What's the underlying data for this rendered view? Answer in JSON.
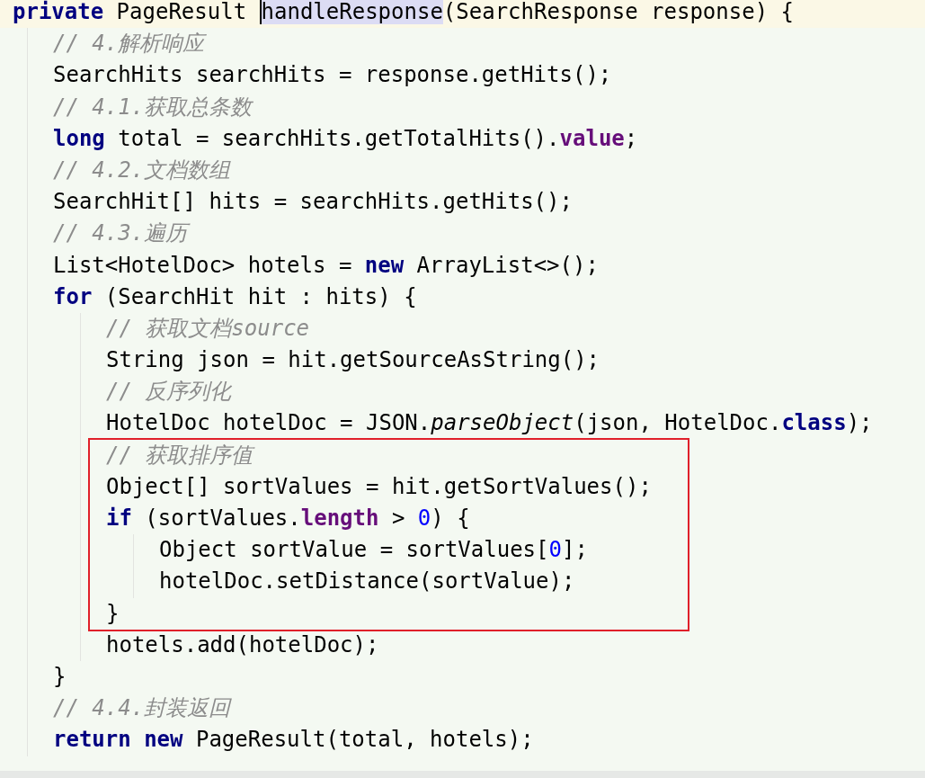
{
  "editor": {
    "lines": [
      {
        "kind": "line",
        "current": true,
        "tokens": [
          {
            "kind": "keyword",
            "text": "private"
          },
          {
            "kind": "text",
            "text": " PageResult "
          },
          {
            "kind": "match",
            "text": "handleResponse"
          },
          {
            "kind": "text",
            "text": "(SearchResponse response) {"
          }
        ],
        "children": [
          {
            "kind": "line",
            "tokens": [
              {
                "kind": "comment",
                "text": "// 4.解析响应"
              }
            ]
          },
          {
            "kind": "line",
            "tokens": [
              {
                "kind": "text",
                "text": "SearchHits searchHits = response.getHits();"
              }
            ]
          },
          {
            "kind": "line",
            "tokens": [
              {
                "kind": "comment",
                "text": "// 4.1.获取总条数"
              }
            ]
          },
          {
            "kind": "line",
            "tokens": [
              {
                "kind": "keyword",
                "text": "long"
              },
              {
                "kind": "text",
                "text": " total = searchHits.getTotalHits()."
              },
              {
                "kind": "field",
                "text": "value"
              },
              {
                "kind": "text",
                "text": ";"
              }
            ]
          },
          {
            "kind": "line",
            "tokens": [
              {
                "kind": "comment",
                "text": "// 4.2.文档数组"
              }
            ]
          },
          {
            "kind": "line",
            "tokens": [
              {
                "kind": "text",
                "text": "SearchHit[] hits = searchHits.getHits();"
              }
            ]
          },
          {
            "kind": "line",
            "tokens": [
              {
                "kind": "comment",
                "text": "// 4.3.遍历"
              }
            ]
          },
          {
            "kind": "line",
            "tokens": [
              {
                "kind": "text",
                "text": "List<HotelDoc> hotels = "
              },
              {
                "kind": "keyword",
                "text": "new"
              },
              {
                "kind": "text",
                "text": " ArrayList<>();"
              }
            ]
          },
          {
            "kind": "line",
            "tokens": [
              {
                "kind": "keyword",
                "text": "for"
              },
              {
                "kind": "text",
                "text": " (SearchHit hit : hits) {"
              }
            ],
            "children": [
              {
                "kind": "line",
                "tokens": [
                  {
                    "kind": "comment",
                    "text": "// 获取文档source"
                  }
                ]
              },
              {
                "kind": "line",
                "tokens": [
                  {
                    "kind": "text",
                    "text": "String json = hit.getSourceAsString();"
                  }
                ]
              },
              {
                "kind": "line",
                "tokens": [
                  {
                    "kind": "comment",
                    "text": "// 反序列化"
                  }
                ]
              },
              {
                "kind": "line",
                "tokens": [
                  {
                    "kind": "text",
                    "text": "HotelDoc hotelDoc = JSON."
                  },
                  {
                    "kind": "italic",
                    "text": "parseObject"
                  },
                  {
                    "kind": "text",
                    "text": "(json, HotelDoc."
                  },
                  {
                    "kind": "keyword",
                    "text": "class"
                  },
                  {
                    "kind": "text",
                    "text": ");"
                  }
                ]
              },
              {
                "kind": "marked_region",
                "children": [
                  {
                    "kind": "line",
                    "tokens": [
                      {
                        "kind": "comment",
                        "text": "// 获取排序值"
                      }
                    ]
                  },
                  {
                    "kind": "line",
                    "tokens": [
                      {
                        "kind": "text",
                        "text": "Object[] sortValues = hit.getSortValues();"
                      }
                    ]
                  },
                  {
                    "kind": "line",
                    "tokens": [
                      {
                        "kind": "keyword",
                        "text": "if"
                      },
                      {
                        "kind": "text",
                        "text": " (sortValues."
                      },
                      {
                        "kind": "field",
                        "text": "length"
                      },
                      {
                        "kind": "text",
                        "text": " > "
                      },
                      {
                        "kind": "number",
                        "text": "0"
                      },
                      {
                        "kind": "text",
                        "text": ") {"
                      }
                    ],
                    "children": [
                      {
                        "kind": "line",
                        "tokens": [
                          {
                            "kind": "text",
                            "text": "Object sortValue = sortValues["
                          },
                          {
                            "kind": "number",
                            "text": "0"
                          },
                          {
                            "kind": "text",
                            "text": "];"
                          }
                        ]
                      },
                      {
                        "kind": "line",
                        "tokens": [
                          {
                            "kind": "text",
                            "text": "hotelDoc.setDistance(sortValue);"
                          }
                        ]
                      }
                    ]
                  },
                  {
                    "kind": "line",
                    "tokens": [
                      {
                        "kind": "text",
                        "text": "}"
                      }
                    ]
                  }
                ]
              },
              {
                "kind": "line",
                "tokens": [
                  {
                    "kind": "text",
                    "text": "hotels.add(hotelDoc);"
                  }
                ]
              }
            ]
          },
          {
            "kind": "line",
            "tokens": [
              {
                "kind": "text",
                "text": "}"
              }
            ]
          },
          {
            "kind": "line",
            "tokens": [
              {
                "kind": "comment",
                "text": "// 4.4.封装返回"
              }
            ]
          },
          {
            "kind": "line",
            "tokens": [
              {
                "kind": "keyword",
                "text": "return"
              },
              {
                "kind": "keyword",
                "text": " new"
              },
              {
                "kind": "text",
                "text": " PageResult(total, hotels);"
              }
            ]
          }
        ]
      }
    ]
  }
}
